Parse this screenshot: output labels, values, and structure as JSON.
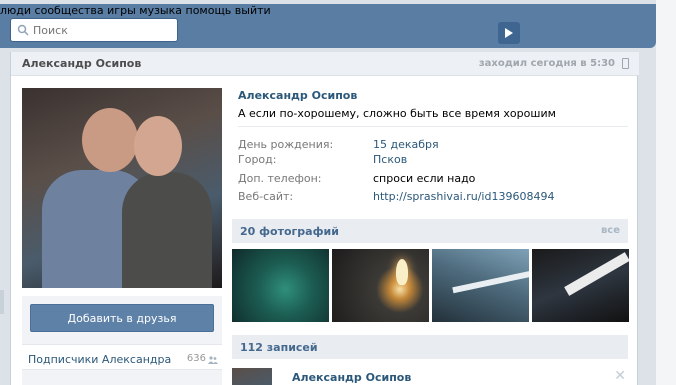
{
  "header": {
    "search_placeholder": "Поиск",
    "nav": [
      "люди",
      "сообщества",
      "игры",
      "музыка",
      "помощь",
      "выйти"
    ]
  },
  "profile": {
    "header_name": "Александр Осипов",
    "last_seen": "заходил сегодня в 5:30",
    "name": "Александр Осипов",
    "status": "А если по-хорошему, сложно быть все время хорошим",
    "fields": [
      {
        "key": "День рождения:",
        "value": "15 декабря"
      },
      {
        "key": "Город:",
        "value": "Псков"
      },
      {
        "key": "Доп. телефон:",
        "value": "спроси если надо"
      },
      {
        "key": "Веб-сайт:",
        "value": "http://sprashivai.ru/id139608494"
      }
    ],
    "add_friend_label": "Добавить в друзья",
    "subscribers_label": "Подписчики Александра",
    "subscribers_count": "636"
  },
  "photos": {
    "title": "20 фотографий",
    "all_label": "все"
  },
  "wall": {
    "title": "112 записей",
    "first_author": "Александр Осипов",
    "close_label": "✕"
  },
  "colors": {
    "header_bg": "#597da3",
    "link": "#2b587a",
    "button": "#5e81a8"
  }
}
